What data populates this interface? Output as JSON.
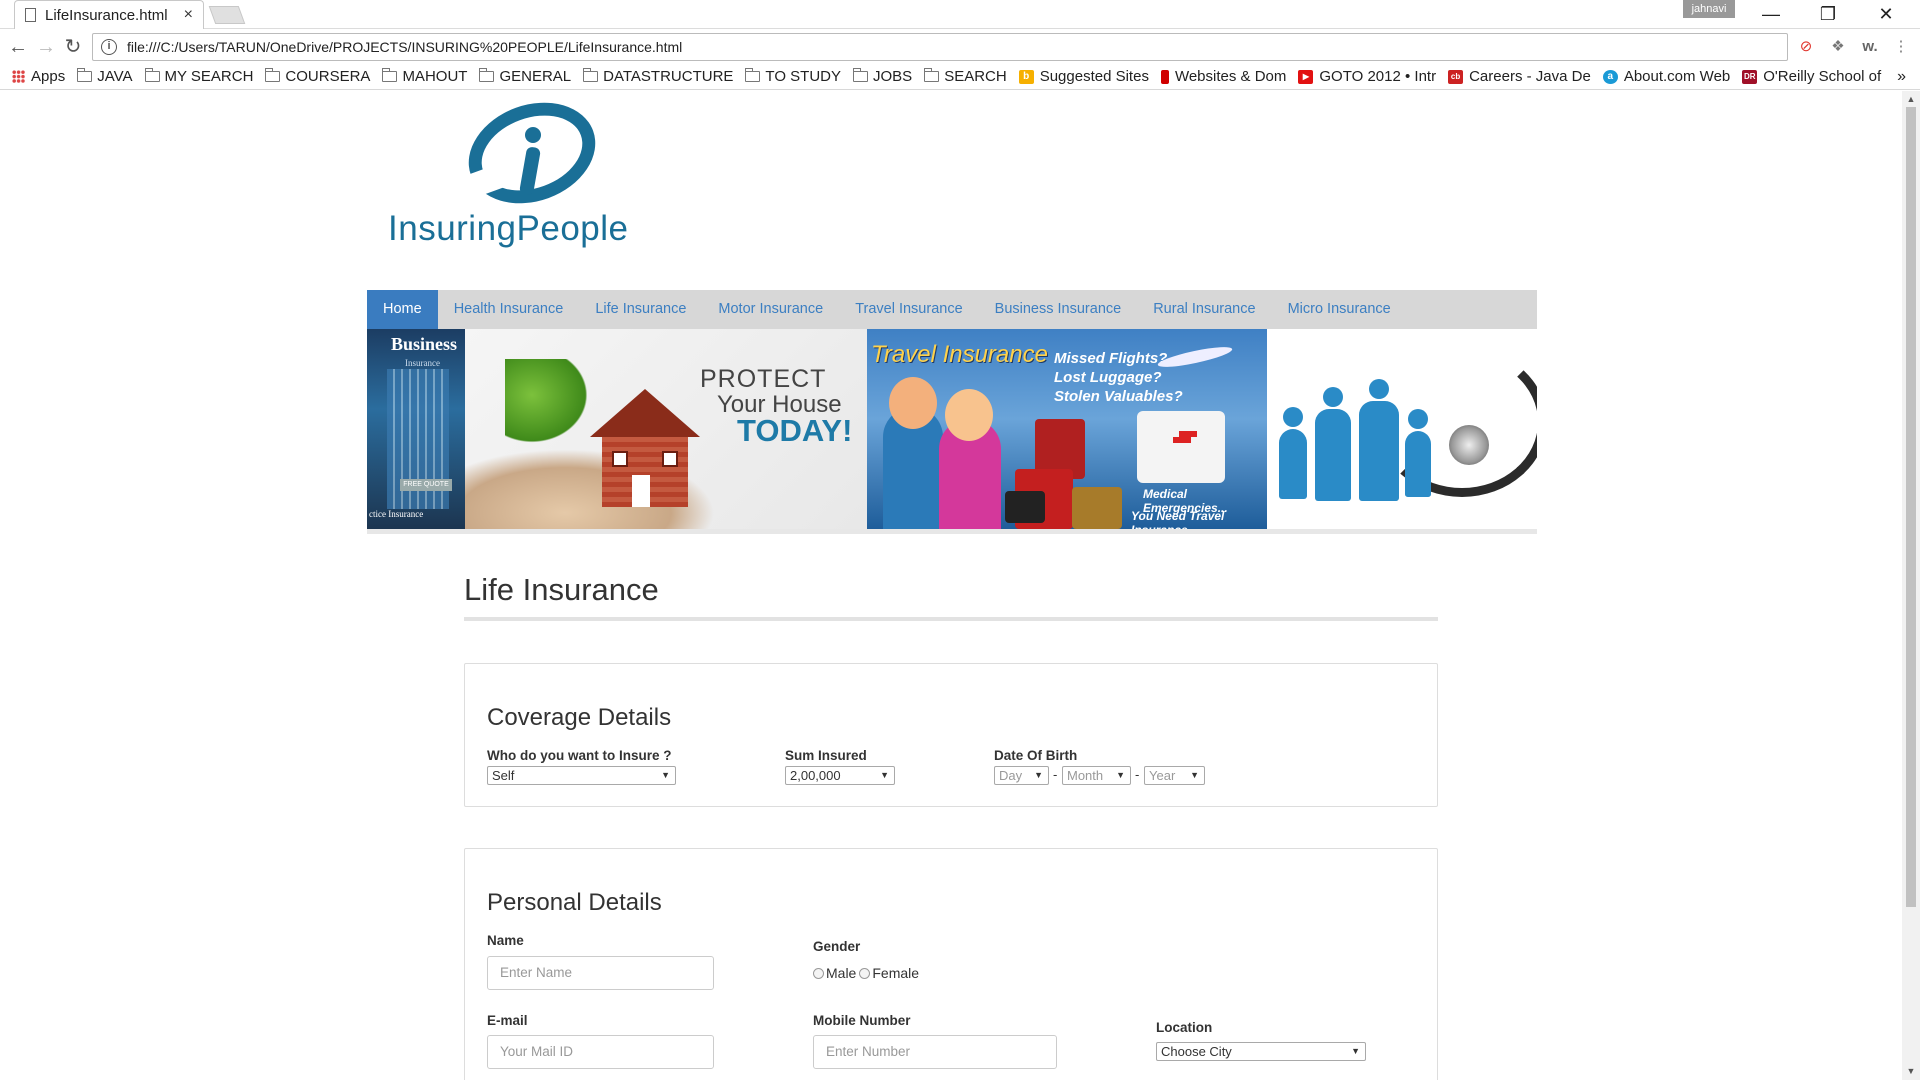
{
  "browser": {
    "tab_title": "LifeInsurance.html",
    "tab_close": "×",
    "user_badge": "jahnavi",
    "win_minimize": "—",
    "win_restore": "❐",
    "win_close": "✕",
    "address": "file:///C:/Users/TARUN/OneDrive/PROJECTS/INSURING%20PEOPLE/LifeInsurance.html",
    "info_glyph": "i",
    "ext_w": "w.",
    "menu_glyph": "⋮"
  },
  "bookmarks": {
    "apps": "Apps",
    "items": [
      "JAVA",
      "MY SEARCH",
      "COURSERA",
      "MAHOUT",
      "GENERAL",
      "DATASTRUCTURE",
      "TO STUDY",
      "JOBS",
      "SEARCH"
    ],
    "sites": [
      {
        "label": "Suggested Sites",
        "icon": "bing-icon",
        "color": "#f6b000",
        "glyph": "b"
      },
      {
        "label": "Websites & Dom",
        "icon": "bars-icon",
        "color": "#d00000",
        "glyph": "||"
      },
      {
        "label": "GOTO 2012 • Intr",
        "icon": "youtube-icon",
        "color": "#e21111",
        "glyph": "▶"
      },
      {
        "label": "Careers - Java De",
        "icon": "careers-icon",
        "color": "#cc2222",
        "glyph": "cb"
      },
      {
        "label": "About.com Web",
        "icon": "about-icon",
        "color": "#1a9ad6",
        "glyph": "a"
      },
      {
        "label": "O'Reilly School of",
        "icon": "oreilly-icon",
        "color": "#a01028",
        "glyph": "DR"
      }
    ],
    "more": "»"
  },
  "site": {
    "logo_text": "InsuringPeople",
    "nav": [
      "Home",
      "Health Insurance",
      "Life Insurance",
      "Motor Insurance",
      "Travel Insurance",
      "Business Insurance",
      "Rural Insurance",
      "Micro Insurance"
    ],
    "banner": {
      "business_title": "Business",
      "business_sub": "Insurance",
      "business_btn": "FREE QUOTE",
      "business_footer": "ctice Insurance",
      "house_line1": "PROTECT",
      "house_line2": "Your House",
      "house_line3": "TODAY!",
      "travel_title": "Travel Insurance",
      "travel_q1": "Missed Flights?",
      "travel_q2": "Lost Luggage?",
      "travel_q3": "Stolen Valuables?",
      "travel_med": "Medical Emergencies...",
      "travel_need": "You Need Travel Insurance"
    }
  },
  "main": {
    "page_title": "Life Insurance",
    "coverage": {
      "title": "Coverage Details",
      "insure_label": "Who do you want to Insure ?",
      "insure_value": "Self",
      "sum_label": "Sum Insured",
      "sum_value": "2,00,000",
      "dob_label": "Date Of Birth",
      "dob_day": "Day",
      "dob_month": "Month",
      "dob_year": "Year",
      "dob_sep": "-"
    },
    "personal": {
      "title": "Personal Details",
      "name_label": "Name",
      "name_placeholder": "Enter Name",
      "gender_label": "Gender",
      "gender_male": "Male",
      "gender_female": "Female",
      "email_label": "E-mail",
      "email_placeholder": "Your Mail ID",
      "mobile_label": "Mobile Number",
      "mobile_placeholder": "Enter Number",
      "location_label": "Location",
      "location_value": "Choose City"
    }
  },
  "colors": {
    "brand": "#1a6f97",
    "nav_active": "#3a7cc0",
    "nav_link": "#3c7fc2",
    "nav_bg": "#d7d7d7"
  }
}
